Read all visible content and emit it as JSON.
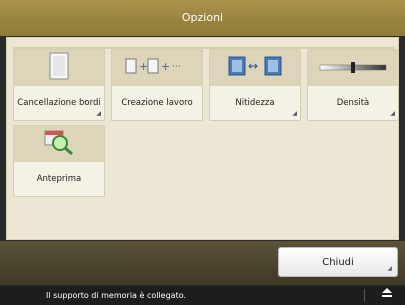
{
  "header": {
    "title": "Opzioni"
  },
  "tiles": [
    {
      "label": "Cancellazione bordi",
      "icon": "document-icon"
    },
    {
      "label": "Creazione lavoro",
      "icon": "job-build-icon"
    },
    {
      "label": "Nitidezza",
      "icon": "sharpness-icon"
    },
    {
      "label": "Densità",
      "icon": "density-slider-icon"
    },
    {
      "label": "Anteprima",
      "icon": "preview-magnifier-icon"
    }
  ],
  "footer": {
    "close_label": "Chiudi"
  },
  "status": {
    "message": "Il supporto di memoria è collegato."
  },
  "colors": {
    "header": "#9c8640",
    "panel": "#ece7d4",
    "tile_icon_bg": "#ddd5b9",
    "bottom_bar": "#4b4530"
  }
}
